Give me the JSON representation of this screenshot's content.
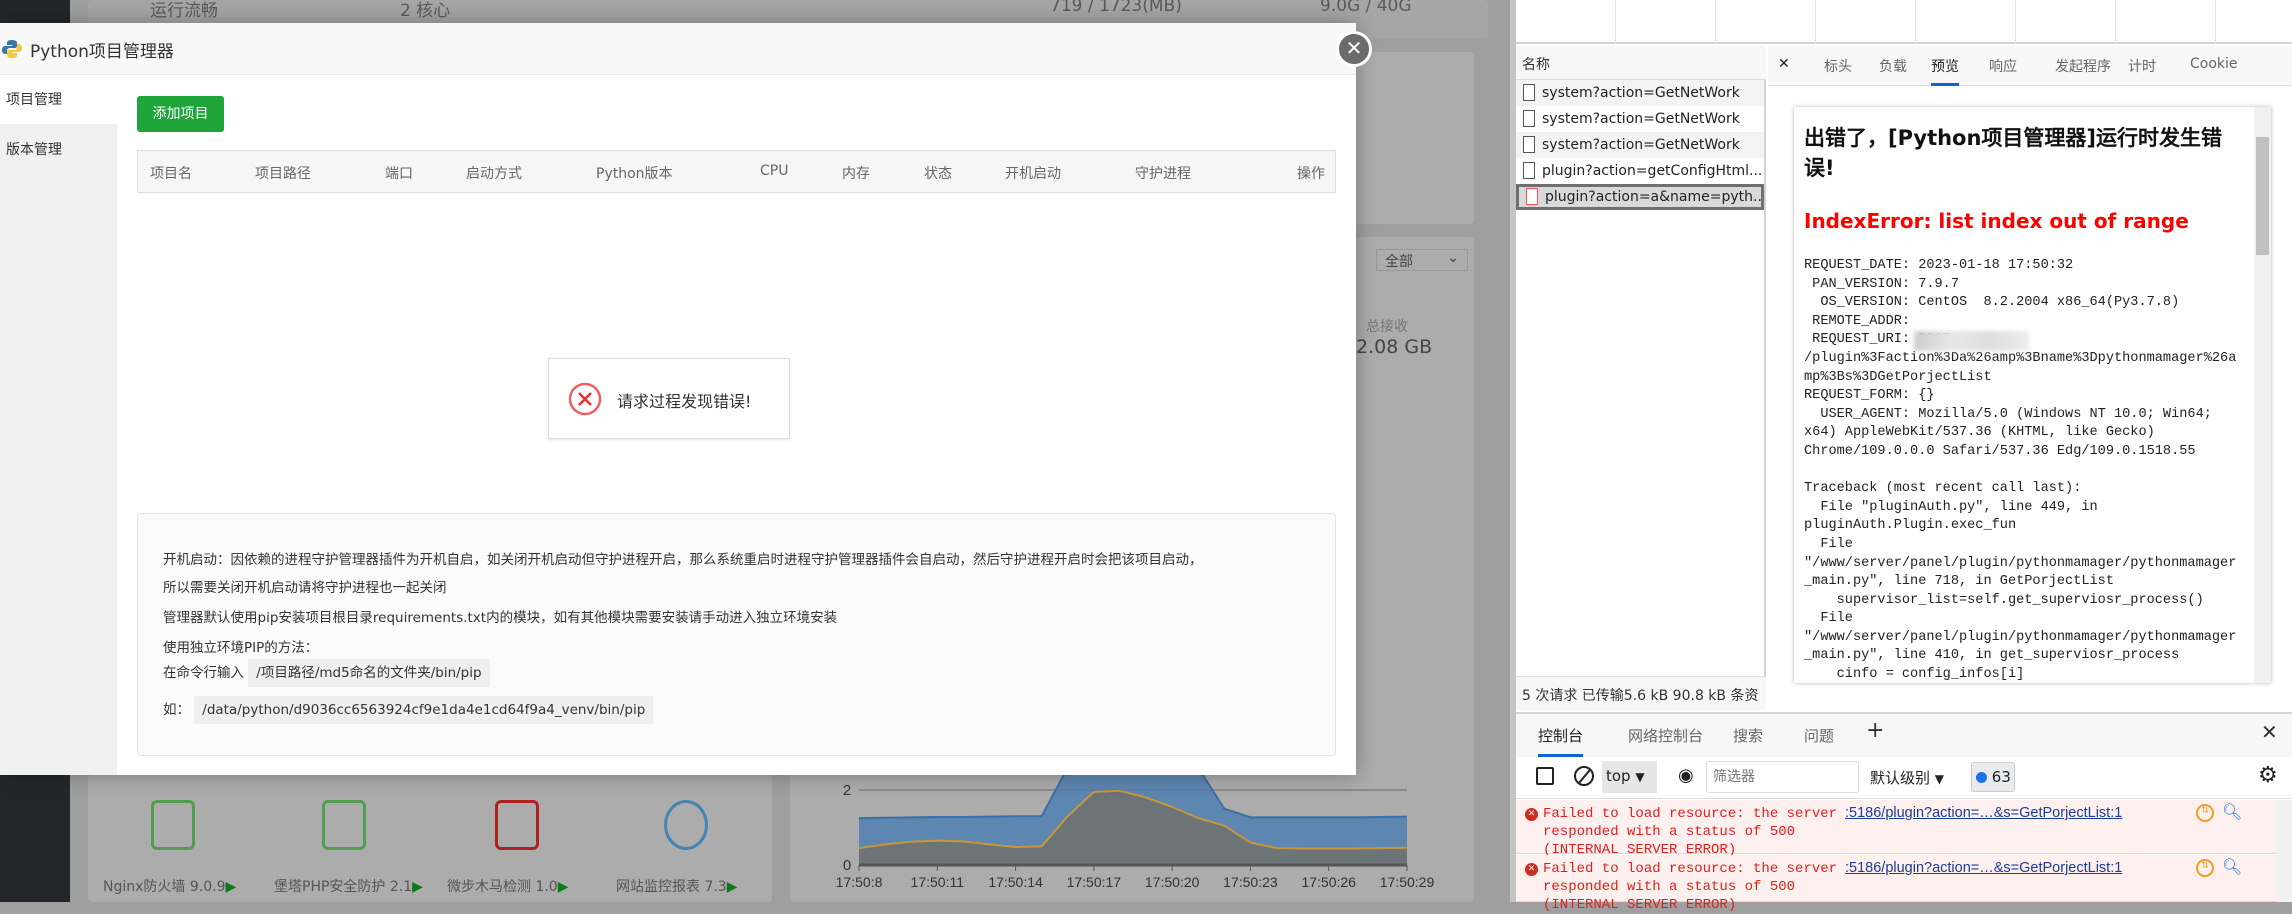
{
  "background": {
    "status_row": [
      "运行流畅",
      "2 核心",
      "719 / 1723(MB)",
      "9.0G / 40G"
    ],
    "filter_select": "全部",
    "total_received_label": "总接收",
    "total_received_value": "2.08 GB",
    "plugins": [
      {
        "label": "Nginx防火墙 9.0.9",
        "icon": "waf-shield-icon"
      },
      {
        "label": "堡塔PHP安全防护 2.1",
        "icon": "php-shield-icon"
      },
      {
        "label": "微步木马检测 1.0",
        "icon": "trojan-detect-icon"
      },
      {
        "label": "网站监控报表 7.3",
        "icon": "target-icon"
      }
    ]
  },
  "chart_data": {
    "type": "area",
    "x": [
      "17:50:8",
      "17:50:9",
      "17:50:10",
      "17:50:11",
      "17:50:12",
      "17:50:13",
      "17:50:14",
      "17:50:15",
      "17:50:16",
      "17:50:17",
      "17:50:18",
      "17:50:19",
      "17:50:20",
      "17:50:21",
      "17:50:22",
      "17:50:23",
      "17:50:24",
      "17:50:25",
      "17:50:26",
      "17:50:27",
      "17:50:28",
      "17:50:29"
    ],
    "xtick_labels": [
      "17:50:8",
      "17:50:11",
      "17:50:14",
      "17:50:17",
      "17:50:20",
      "17:50:23",
      "17:50:26",
      "17:50:29"
    ],
    "ytick_labels": [
      "0",
      "2"
    ],
    "series": [
      {
        "values": [
          1.25,
          1.26,
          1.27,
          1.28,
          1.28,
          1.29,
          1.3,
          1.3,
          2.6,
          4.2,
          4.6,
          4.5,
          3.8,
          2.6,
          1.5,
          1.27,
          1.27,
          1.27,
          1.27,
          1.27,
          1.28,
          1.29
        ],
        "color": "#4f7fb0"
      },
      {
        "values": [
          0.45,
          0.55,
          0.62,
          0.65,
          0.63,
          0.55,
          0.48,
          0.5,
          1.3,
          1.95,
          1.98,
          1.8,
          1.55,
          1.25,
          1.05,
          0.6,
          0.45,
          0.44,
          0.44,
          0.44,
          0.45,
          0.46
        ],
        "color": "#6e7272",
        "line_color": "#c8963a"
      }
    ],
    "grid": true
  },
  "modal": {
    "title": "Python项目管理器",
    "close_icon": "close-icon",
    "nav": [
      "项目管理",
      "版本管理"
    ],
    "add_button": "添加项目",
    "columns": [
      "项目名",
      "项目路径",
      "端口",
      "启动方式",
      "Python版本",
      "CPU",
      "内存",
      "状态",
      "开机启动",
      "守护进程",
      "操作"
    ],
    "error_toast": "请求过程发现错误!",
    "info": {
      "line1": "开机启动：因依赖的进程守护管理器插件为开机自启，如关闭开机启动但守护进程开启，那么系统重启时进程守护管理器插件会自启动，然后守护进程开启时会把该项目启动，",
      "line2": "所以需要关闭开机启动请将守护进程也一起关闭",
      "line3": "管理器默认使用pip安装项目根目录requirements.txt内的模块，如有其他模块需要安装请手动进入独立环境安装",
      "line4": "使用独立环境PIP的方法：",
      "line5_label": "在命令行输入",
      "line5_code": "/项目路径/md5命名的文件夹/bin/pip",
      "line6_label": "如：",
      "line6_code": "/data/python/d9036cc6563924cf9e1da4e1cd64f9a4_venv/bin/pip"
    }
  },
  "devtools": {
    "list_header": "名称",
    "requests": [
      "system?action=GetNetWork",
      "system?action=GetNetWork",
      "system?action=GetNetWork",
      "plugin?action=getConfigHtml...",
      "plugin?action=a&name=pyth..."
    ],
    "status": "5 次请求  已传输5.6 kB  90.8 kB 条资",
    "detail_tabs": [
      "标头",
      "负载",
      "预览",
      "响应",
      "发起程序",
      "计时",
      "Cookie"
    ],
    "active_tab": "预览",
    "preview": {
      "title": "出错了，[Python项目管理器]运行时发生错误!",
      "error": "IndexError: list index out of range",
      "lines": [
        "REQUEST_DATE: 2023-01-18 17:50:32",
        " PAN_VERSION: 7.9.7",
        "  OS_VERSION: CentOS  8.2.2004 x86_64(Py3.7.8)",
        " REMOTE_ADDR: ",
        " REQUEST_URI: POST",
        "/plugin%3Faction%3Da%26amp%3Bname%3Dpythonmamager%26a",
        "mp%3Bs%3DGetPorjectList",
        "REQUEST_FORM: {}",
        "  USER_AGENT: Mozilla/5.0 (Windows NT 10.0; Win64;",
        "x64) AppleWebKit/537.36 (KHTML, like Gecko)",
        "Chrome/109.0.0.0 Safari/537.36 Edg/109.0.1518.55",
        "",
        "Traceback (most recent call last):",
        "  File \"pluginAuth.py\", line 449, in",
        "pluginAuth.Plugin.exec_fun",
        "  File",
        "\"/www/server/panel/plugin/pythonmamager/pythonmamager",
        "_main.py\", line 718, in GetPorjectList",
        "    supervisor_list=self.get_superviosr_process()",
        "  File",
        "\"/www/server/panel/plugin/pythonmamager/pythonmamager",
        "_main.py\", line 410, in get_superviosr_process",
        "    cinfo = config_infos[i]",
        "IndexError: list index out of range"
      ]
    },
    "console_tabs": [
      "控制台",
      "网络控制台",
      "搜索",
      "问题"
    ],
    "context_select": "top",
    "filter_placeholder": "筛选器",
    "level_select": "默认级别",
    "message_count": "63",
    "messages": [
      {
        "text": "Failed to load resource: the server\nresponded with a status of 500\n(INTERNAL SERVER ERROR)",
        "link": ":5186/plugin?action=…&s=GetPorjectList:1"
      },
      {
        "text": "Failed to load resource: the server\nresponded with a status of 500\n(INTERNAL SERVER ERROR)",
        "link": ":5186/plugin?action=…&s=GetPorjectList:1"
      }
    ],
    "error_color": "#e0201b"
  }
}
